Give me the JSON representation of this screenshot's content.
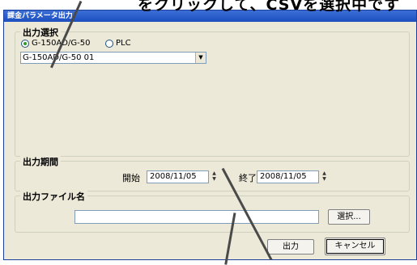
{
  "callout_top": "をクリックして、CSVを選択中です",
  "window": {
    "title": "課金パラメータ出力"
  },
  "output_select": {
    "title": "出力選択",
    "options": [
      {
        "label": "G-150AD/G-50",
        "selected": true
      },
      {
        "label": "PLC",
        "selected": false
      }
    ],
    "combo_value": "G-150AD/G-50 01"
  },
  "period": {
    "title": "出力期間",
    "start_label": "開始",
    "start_value": "2008/11/05",
    "end_label": "終了",
    "end_value": "2008/11/05"
  },
  "file": {
    "title": "出力ファイル名",
    "value": "",
    "browse_label": "選択..."
  },
  "buttons": {
    "output": "出力",
    "cancel": "キャンセル"
  }
}
